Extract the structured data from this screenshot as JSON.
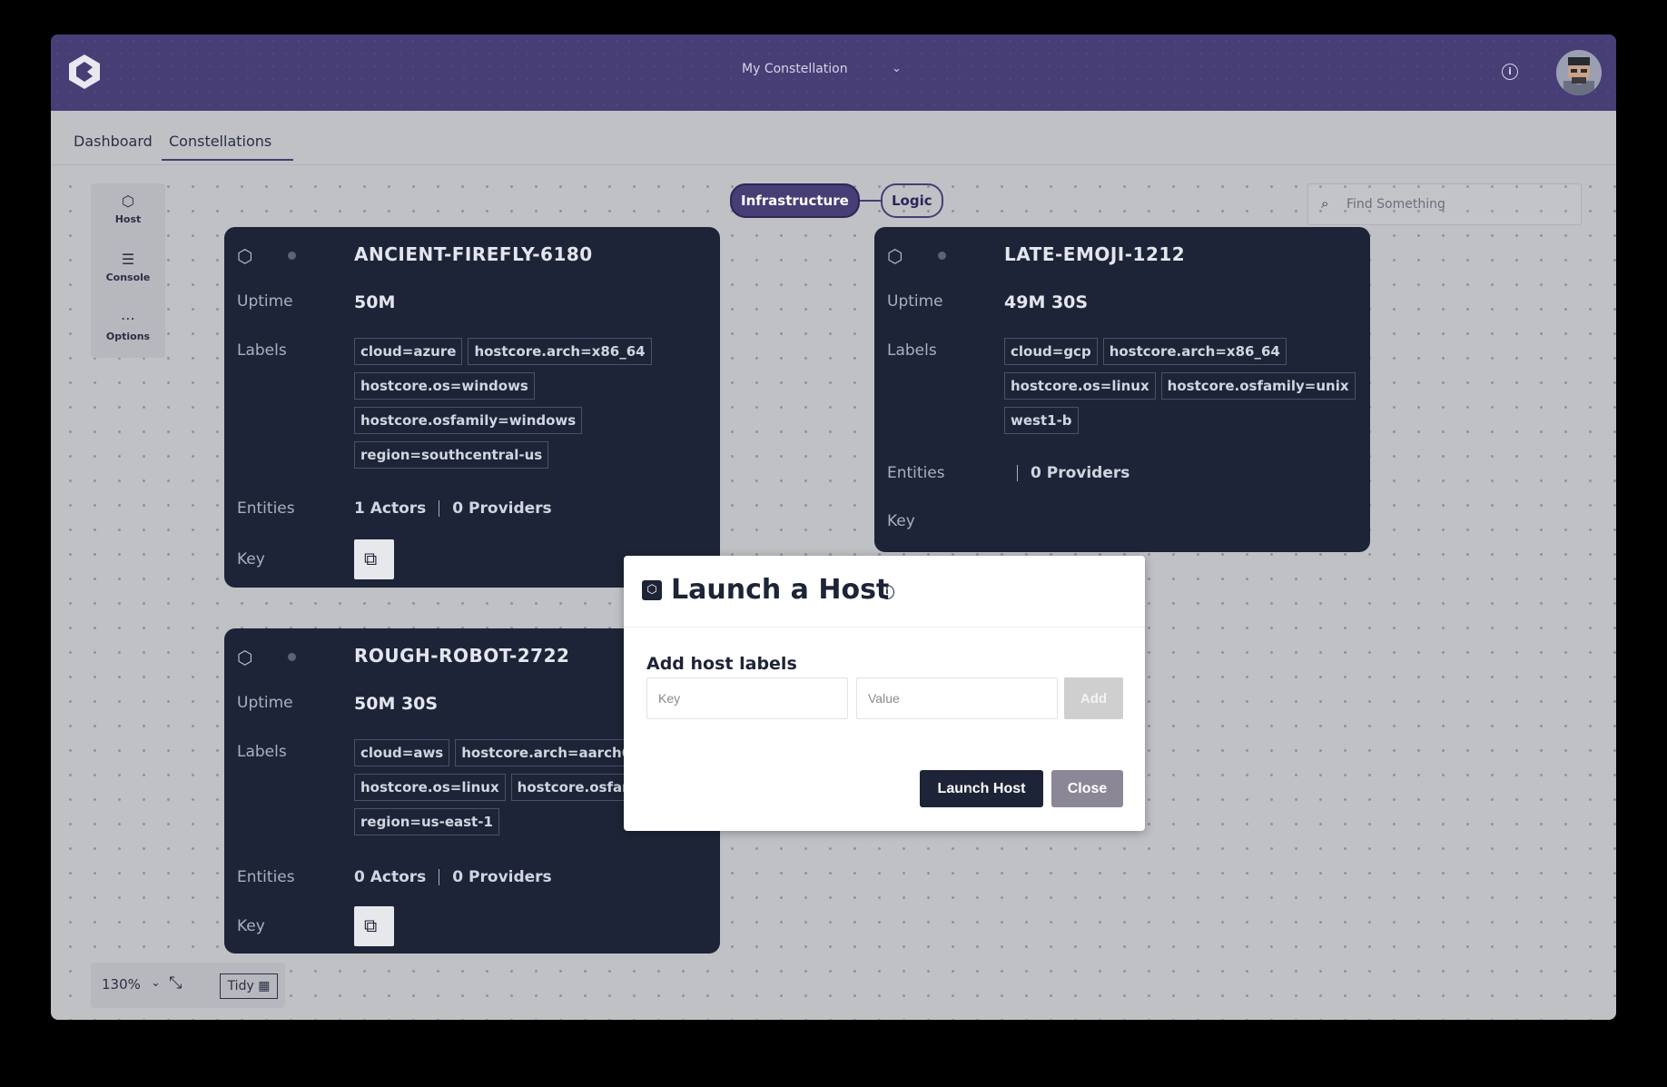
{
  "header": {
    "constellation_selector": "My Constellation",
    "colors": {
      "topbar": "#463e75",
      "card": "#1e2437"
    }
  },
  "nav": {
    "tabs": [
      {
        "label": "Dashboard"
      },
      {
        "label": "Constellations"
      }
    ]
  },
  "toolbar": {
    "host": "Host",
    "console": "Console",
    "options": "Options"
  },
  "view_toggle": {
    "infrastructure": "Infrastructure",
    "logic": "Logic"
  },
  "search": {
    "placeholder": "Find Something"
  },
  "cards": [
    {
      "title": "ANCIENT-FIREFLY-6180",
      "uptime_label": "Uptime",
      "uptime": "50M",
      "labels_label": "Labels",
      "labels": [
        "cloud=azure",
        "hostcore.arch=x86_64",
        "hostcore.os=windows",
        "hostcore.osfamily=windows",
        "region=southcentral-us"
      ],
      "entities_label": "Entities",
      "actors": "1 Actors",
      "providers": "0 Providers",
      "key_label": "Key"
    },
    {
      "title": "LATE-EMOJI-1212",
      "uptime_label": "Uptime",
      "uptime": "49M 30S",
      "labels_label": "Labels",
      "labels": [
        "cloud=gcp",
        "hostcore.arch=x86_64",
        "hostcore.os=linux",
        "hostcore.osfamily=unix",
        "west1-b"
      ],
      "entities_label": "Entities",
      "actors": "",
      "providers": "0 Providers",
      "key_label": "Key"
    },
    {
      "title": "ROUGH-ROBOT-2722",
      "uptime_label": "Uptime",
      "uptime": "50M 30S",
      "labels_label": "Labels",
      "labels": [
        "cloud=aws",
        "hostcore.arch=aarch64",
        "hostcore.os=linux",
        "hostcore.osfamily=unix",
        "region=us-east-1"
      ],
      "entities_label": "Entities",
      "actors": "0 Actors",
      "providers": "0 Providers",
      "key_label": "Key"
    }
  ],
  "zoom": {
    "level": "130%",
    "tidy": "Tidy"
  },
  "modal": {
    "title": "Launch a Host",
    "subtitle": "Add host labels",
    "key_placeholder": "Key",
    "value_placeholder": "Value",
    "add": "Add",
    "launch": "Launch Host",
    "close": "Close"
  }
}
